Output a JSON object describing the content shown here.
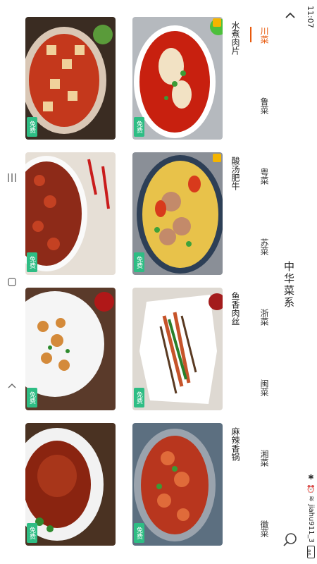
{
  "status_bar": {
    "time": "11:07",
    "carrier": "jiahu911_3",
    "battery": "86"
  },
  "header": {
    "title": "中华菜系"
  },
  "tabs": [
    {
      "label": "川菜",
      "active": true
    },
    {
      "label": "鲁菜",
      "active": false
    },
    {
      "label": "粤菜",
      "active": false
    },
    {
      "label": "苏菜",
      "active": false
    },
    {
      "label": "浙菜",
      "active": false
    },
    {
      "label": "闽菜",
      "active": false
    },
    {
      "label": "湘菜",
      "active": false
    },
    {
      "label": "徽菜",
      "active": false
    }
  ],
  "dishes": [
    {
      "title": "水煮肉片",
      "badge": "免费",
      "featured": true
    },
    {
      "title": "",
      "badge": "免费",
      "featured": false
    },
    {
      "title": "酸汤肥牛",
      "badge": "免费",
      "featured": true
    },
    {
      "title": "",
      "badge": "免费",
      "featured": false
    },
    {
      "title": "鱼香肉丝",
      "badge": "免费",
      "featured": false
    },
    {
      "title": "",
      "badge": "免费",
      "featured": false
    },
    {
      "title": "麻辣香锅",
      "badge": "免费",
      "featured": false
    },
    {
      "title": "",
      "badge": "免费",
      "featured": false
    }
  ],
  "colors": {
    "accent": "#e8590c",
    "free_badge": "#2ebd84",
    "featured_badge": "#f4b400"
  }
}
